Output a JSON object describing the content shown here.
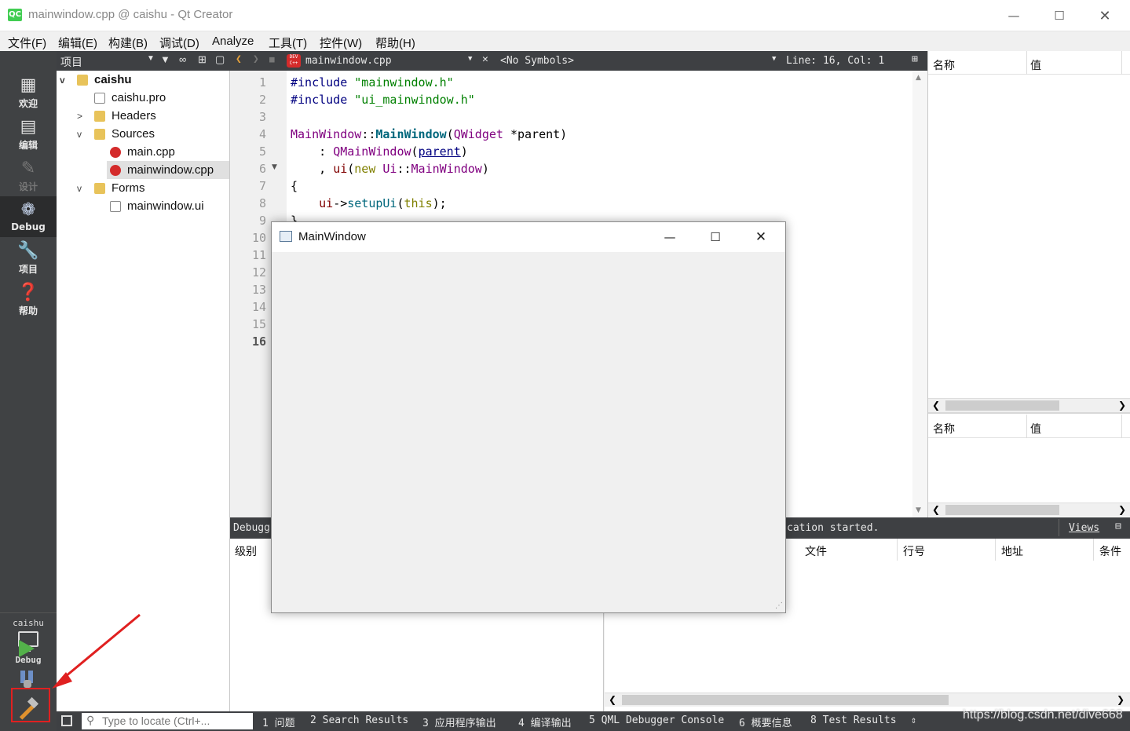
{
  "window": {
    "title": "mainwindow.cpp @ caishu - Qt Creator",
    "logo_text": "QC"
  },
  "menu": [
    "文件(F)",
    "编辑(E)",
    "构建(B)",
    "调试(D)",
    "Analyze",
    "工具(T)",
    "控件(W)",
    "帮助(H)"
  ],
  "modes": [
    {
      "icon": "grid-icon",
      "label": "欢迎"
    },
    {
      "icon": "document-icon",
      "label": "编辑"
    },
    {
      "icon": "pencil-icon",
      "label": "设计"
    },
    {
      "icon": "bug-icon",
      "label": "Debug"
    },
    {
      "icon": "wrench-icon",
      "label": "项目"
    },
    {
      "icon": "help-icon",
      "label": "帮助"
    }
  ],
  "kit": {
    "project": "caishu",
    "mode": "Debug"
  },
  "sidebar": {
    "title": "项目",
    "tree": [
      {
        "label": "caishu",
        "level": 0,
        "expanded": "v",
        "icon": "project-folder-icon"
      },
      {
        "label": "caishu.pro",
        "level": 1,
        "expanded": "",
        "icon": "pro-file-icon"
      },
      {
        "label": "Headers",
        "level": 1,
        "expanded": ">",
        "icon": "headers-folder-icon"
      },
      {
        "label": "Sources",
        "level": 1,
        "expanded": "v",
        "icon": "sources-folder-icon"
      },
      {
        "label": "main.cpp",
        "level": 2,
        "expanded": "",
        "icon": "cpp-file-icon"
      },
      {
        "label": "mainwindow.cpp",
        "level": 2,
        "expanded": "",
        "icon": "cpp-file-icon",
        "selected": true
      },
      {
        "label": "Forms",
        "level": 1,
        "expanded": "v",
        "icon": "forms-folder-icon"
      },
      {
        "label": "mainwindow.ui",
        "level": 2,
        "expanded": "",
        "icon": "ui-file-icon"
      }
    ]
  },
  "editor": {
    "file_badge": "DEV C++",
    "file_name": "mainwindow.cpp",
    "symbols": "<No Symbols>",
    "position": "Line: 16, Col: 1",
    "line_numbers": [
      "1",
      "2",
      "3",
      "4",
      "5",
      "6",
      "7",
      "8",
      "9",
      "10",
      "11",
      "12",
      "13",
      "14",
      "15",
      "16"
    ],
    "code": [
      "#include \"mainwindow.h\"",
      "#include \"ui_mainwindow.h\"",
      "",
      "MainWindow::MainWindow(QWidget *parent)",
      "    : QMainWindow(parent)",
      "    , ui(new Ui::MainWindow)",
      "{",
      "    ui->setupUi(this);",
      "}"
    ]
  },
  "right_panel": {
    "col_name": "名称",
    "col_value": "值"
  },
  "output": {
    "left_title": "Debugg",
    "right_title": "cation started.",
    "views_label": "Views",
    "left_col": "级别",
    "right_cols": [
      "文件",
      "行号",
      "地址",
      "条件"
    ]
  },
  "status": {
    "locate_placeholder": "Type to locate (Ctrl+...",
    "tabs": [
      "1 问题",
      "2 Search Results",
      "3 应用程序输出",
      "4 编译输出",
      "5 QML Debugger Console",
      "6 概要信息",
      "8 Test Results"
    ]
  },
  "app_window": {
    "title": "MainWindow"
  },
  "watermark": "https://blog.csdn.net/dive668",
  "colors": {
    "accent": "#41cd52",
    "annotation": "#e02020",
    "dark_panel": "#404244"
  }
}
